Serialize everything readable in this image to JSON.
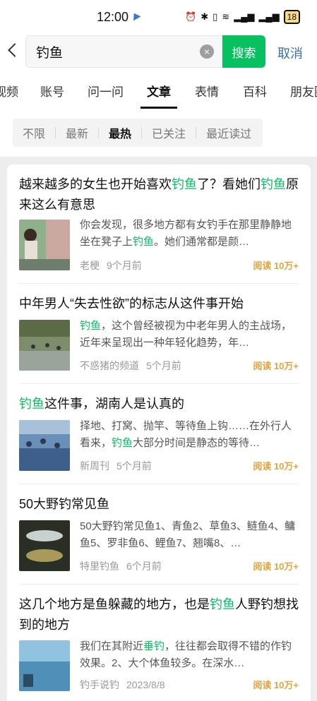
{
  "status": {
    "time": "12:00",
    "battery": "18"
  },
  "search": {
    "value": "钓鱼",
    "button": "搜索",
    "cancel": "取消"
  },
  "tabs": [
    "视频",
    "账号",
    "问一问",
    "文章",
    "表情",
    "百科",
    "朋友圈"
  ],
  "filters": [
    "不限",
    "最新",
    "最热",
    "已关注",
    "最近读过"
  ],
  "articles": [
    {
      "title_parts": [
        "越来越多的女生也开始喜欢",
        "钓鱼",
        "了？看她们",
        "钓鱼",
        "原来这么有意思"
      ],
      "snippet_parts": [
        "你会发现，很多地方都有女钓手在那里静静地坐在凳子上",
        "钓鱼",
        "。她们通常都是颜…"
      ],
      "source": "老梗",
      "time": "9个月前",
      "read": "阅读 10万+"
    },
    {
      "title_parts": [
        "中年男人“失去性欲”的标志从这件事开始"
      ],
      "snippet_parts": [
        "钓鱼",
        "，这个曾经被视为中老年男人的主战场，近年来呈现出一种年轻化趋势，年…"
      ],
      "source": "不惑猪的频道",
      "time": "5个月前",
      "read": "阅读 10万+"
    },
    {
      "title_parts": [
        "钓鱼",
        "这件事，湖南人是认真的"
      ],
      "snippet_parts": [
        "择地、打窝、抛竿、等待鱼上钩……在外行人看来，",
        "钓鱼",
        "大部分时间是静态的等待…"
      ],
      "source": "新周刊",
      "time": "5个月前",
      "read": "阅读 10万+"
    },
    {
      "title_parts": [
        "50大野钓常见鱼"
      ],
      "snippet_parts": [
        "50大野钓常见鱼1、青鱼2、草鱼3、鲢鱼4、鳙鱼5、罗非鱼6、鲤鱼7、翘嘴8、…"
      ],
      "source": "特里钓鱼",
      "time": "6个月前",
      "read": "阅读 10万+"
    },
    {
      "title_parts": [
        "这几个地方是鱼躲藏的地方，也是",
        "钓鱼",
        "人野钓想找到的地方"
      ],
      "snippet_parts": [
        "我们在其附近",
        "垂钓",
        "，往往都会取得不错的作钓效果。2、大个体鱼较多。在深水…"
      ],
      "source": "钓手说钓",
      "time": "2023/8/8",
      "read": "阅读 10万+"
    }
  ],
  "colors": {
    "accent": "#07c160",
    "read": "#e6a23c",
    "link": "#3a6fb0"
  }
}
